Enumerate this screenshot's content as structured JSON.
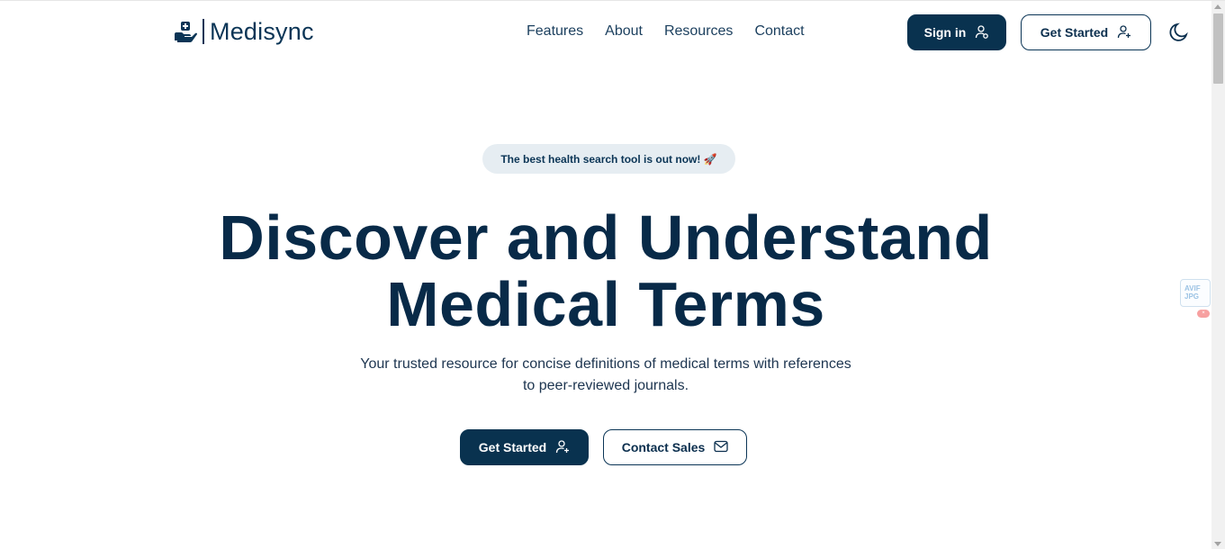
{
  "brand": {
    "name": "Medisync",
    "color": "#0b3556"
  },
  "nav": {
    "items": [
      {
        "label": "Features"
      },
      {
        "label": "About"
      },
      {
        "label": "Resources"
      },
      {
        "label": "Contact"
      }
    ]
  },
  "header": {
    "signin_label": "Sign in",
    "get_started_label": "Get Started",
    "theme_icon": "moon-icon"
  },
  "hero": {
    "badge_text": "The best health search tool is out now! 🚀",
    "title_line1": "Discover and Understand",
    "title_line2": "Medical Terms",
    "subtitle": "Your trusted resource for concise definitions of medical terms with references to peer-reviewed journals.",
    "primary_cta": "Get Started",
    "secondary_cta": "Contact Sales"
  },
  "extension": {
    "line1": "AVIF",
    "line2": "JPG"
  },
  "colors": {
    "primary": "#09324f",
    "badge_bg": "#e6edf2",
    "text": "#082a48"
  }
}
